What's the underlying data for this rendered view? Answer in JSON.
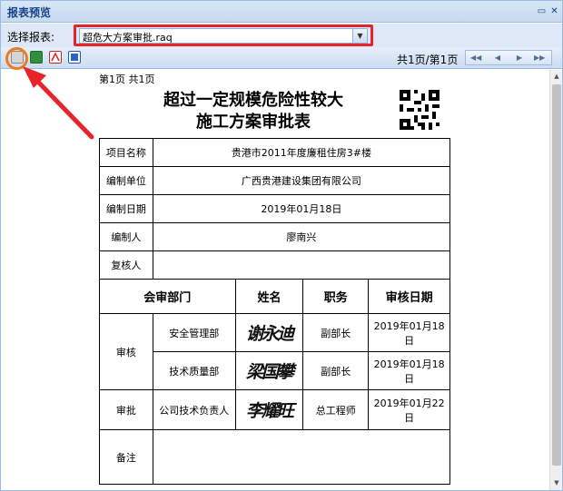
{
  "window": {
    "title": "报表预览"
  },
  "selector": {
    "label": "选择报表:",
    "value": "超危大方案审批.raq"
  },
  "toolbar": {
    "page_count": "共1页/第1页",
    "icons": [
      "print-icon",
      "excel-icon",
      "pdf-icon",
      "word-icon"
    ],
    "nav": [
      "first-page-icon",
      "prev-page-icon",
      "next-page-icon",
      "last-page-icon"
    ]
  },
  "report": {
    "page_info": "第1页  共1页",
    "title_line1": "超过一定规模危险性较大",
    "title_line2": "施工方案审批表",
    "rows": [
      {
        "label": "项目名称",
        "value": "贵港市2011年度廉租住房3#楼"
      },
      {
        "label": "编制单位",
        "value": "广西贵港建设集团有限公司"
      },
      {
        "label": "编制日期",
        "value": "2019年01月18日"
      },
      {
        "label": "编制人",
        "value": "廖南兴"
      },
      {
        "label": "复核人",
        "value": ""
      }
    ],
    "review_headers": {
      "dept": "会审部门",
      "name": "姓名",
      "position": "职务",
      "date": "审核日期"
    },
    "review_group_label": "审核",
    "approve_label": "审批",
    "review_rows": [
      {
        "dept": "安全管理部",
        "signature": "谢永迪",
        "position": "副部长",
        "date": "2019年01月18日"
      },
      {
        "dept": "技术质量部",
        "signature": "梁国攀",
        "position": "副部长",
        "date": "2019年01月18日"
      },
      {
        "dept": "公司技术负责人",
        "signature": "李耀旺",
        "position": "总工程师",
        "date": "2019年01月22日"
      }
    ],
    "note_label": "备注"
  },
  "colors": {
    "highlight_red": "#e8242b",
    "highlight_orange": "#f07b1a",
    "title_blue": "#15428b"
  }
}
